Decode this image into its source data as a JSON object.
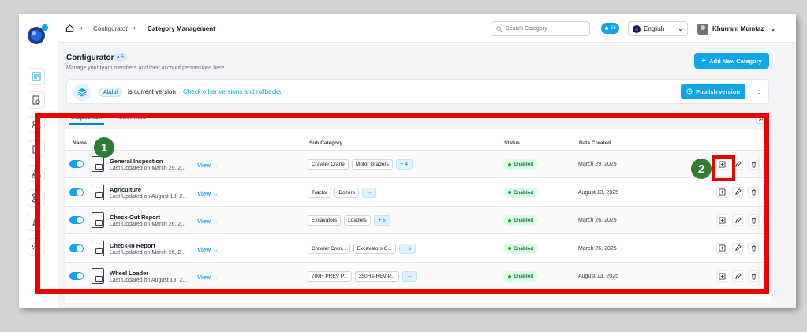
{
  "breadcrumb": {
    "parent": "Configurator",
    "current": "Category Management"
  },
  "search": {
    "placeholder": "Search Category"
  },
  "notifications": {
    "count": "15"
  },
  "language": {
    "selected": "English"
  },
  "user": {
    "name": "Khurram Mumtaz"
  },
  "header": {
    "title": "Configurator",
    "count": "5",
    "subtitle": "Manage your team members and their account permissions here.",
    "add_button": "Add New Category"
  },
  "version": {
    "name": "Abdul",
    "text": "is current version",
    "link": "Check other versions and rollbacks.",
    "publish_button": "Publish version"
  },
  "tabs": [
    {
      "label": "Inspection",
      "active": true
    },
    {
      "label": "Machines",
      "active": false
    }
  ],
  "table": {
    "columns": {
      "name": "Name",
      "sub_category": "Sub Category",
      "status": "Status",
      "date_created": "Date Created"
    },
    "view_label": "View",
    "rows": [
      {
        "name": "General Inspection",
        "updated": "Last Updated on March 29, 2...",
        "chips": [
          "Crawler Crane",
          "Motor Graders"
        ],
        "more": "+ 4",
        "status": "Enabled",
        "date": "March 29, 2025"
      },
      {
        "name": "Agriculture",
        "updated": "Last Updated on August 13, 2...",
        "chips": [
          "Tractor",
          "Dozers"
        ],
        "more": "→",
        "status": "Enabled",
        "date": "August 13, 2025"
      },
      {
        "name": "Check-Out Report",
        "updated": "Last Updated on March 26, 2...",
        "chips": [
          "Excavators",
          "Loaders"
        ],
        "more": "+ 5",
        "status": "Enabled",
        "date": "March 26, 2025"
      },
      {
        "name": "Check-In Report",
        "updated": "Last Updated on March 26, 2...",
        "chips": [
          "Crawler Cran...",
          "Excavators C..."
        ],
        "more": "+ 6",
        "status": "Enabled",
        "date": "March 26, 2025"
      },
      {
        "name": "Wheel Loader",
        "updated": "Last Updated on August 13, 2...",
        "chips": [
          "700H PREV P...",
          "350H PREV P..."
        ],
        "more": "→",
        "status": "Enabled",
        "date": "August 13, 2025"
      }
    ]
  },
  "annotations": {
    "marker1": "1",
    "marker2": "2",
    "highlight_color": "#ef0000",
    "marker_color": "#2e7d32"
  },
  "colors": {
    "accent": "#0ea5e9",
    "status_enabled": "#15803d"
  }
}
